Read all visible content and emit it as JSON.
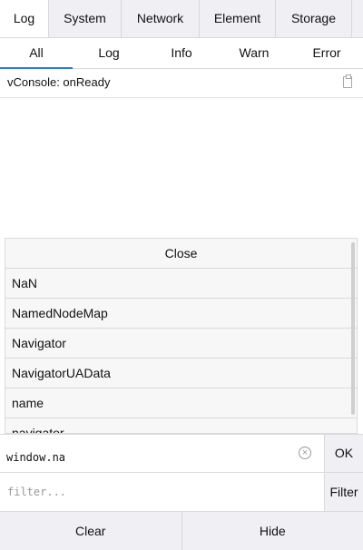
{
  "tabs": [
    {
      "label": "Log",
      "active": true
    },
    {
      "label": "System"
    },
    {
      "label": "Network"
    },
    {
      "label": "Element"
    },
    {
      "label": "Storage"
    }
  ],
  "subtabs": [
    {
      "label": "All",
      "active": true
    },
    {
      "label": "Log"
    },
    {
      "label": "Info"
    },
    {
      "label": "Warn"
    },
    {
      "label": "Error"
    }
  ],
  "log": {
    "lines": [
      "vConsole: onReady"
    ],
    "copy_icon": "clipboard-icon"
  },
  "autocomplete": {
    "close_label": "Close",
    "items": [
      "NaN",
      "NamedNodeMap",
      "Navigator",
      "NavigatorUAData",
      "name",
      "navigator"
    ]
  },
  "command": {
    "value": "window.na",
    "clear_icon": "clear-circle-icon",
    "ok_label": "OK"
  },
  "filter": {
    "placeholder": "filter...",
    "button_label": "Filter"
  },
  "toolbar": {
    "clear_label": "Clear",
    "hide_label": "Hide"
  },
  "colors": {
    "accent": "#2b7bd9",
    "bar_bg": "#efeff4",
    "border": "#d9d9d9"
  }
}
